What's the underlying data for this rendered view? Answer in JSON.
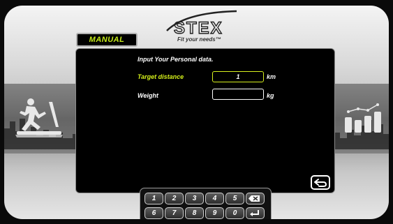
{
  "brand": {
    "tagline": "Fit your needs™"
  },
  "mode_tab": {
    "label": "MANUAL"
  },
  "form": {
    "heading": "Input Your Personal data.",
    "rows": [
      {
        "label": "Target distance",
        "value": "1",
        "unit": "km",
        "label_color": "#d4ef1a"
      },
      {
        "label": "Weight",
        "value": "",
        "unit": "kg",
        "label_color": "#ffffff"
      }
    ]
  },
  "keypad": {
    "row1": [
      "1",
      "2",
      "3",
      "4",
      "5"
    ],
    "row2": [
      "6",
      "7",
      "8",
      "9",
      "0"
    ],
    "backspace_icon": "backspace-icon",
    "enter_icon": "enter-icon"
  },
  "back_button": {
    "icon": "return-arrow-icon"
  },
  "colors": {
    "accent": "#d4ef1a",
    "panel": "#000000"
  }
}
